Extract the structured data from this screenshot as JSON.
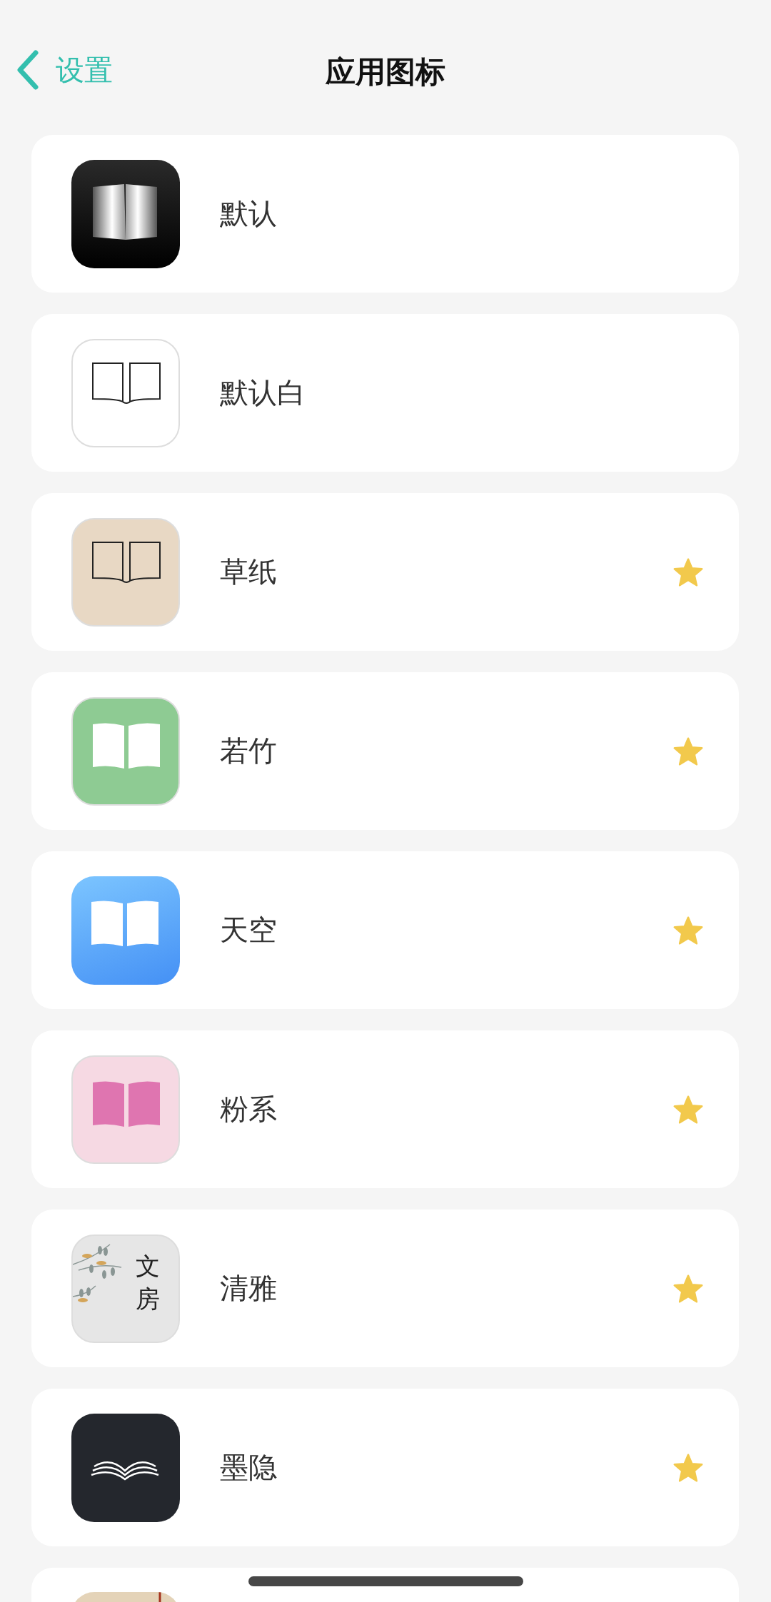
{
  "header": {
    "back_label": "设置",
    "title": "应用图标"
  },
  "icons": [
    {
      "kind": "dark-gradient",
      "label": "默认",
      "starred": false
    },
    {
      "kind": "outline-white",
      "label": "默认白",
      "starred": false
    },
    {
      "kind": "outline-beige",
      "label": "草纸",
      "starred": true
    },
    {
      "kind": "solid-green",
      "label": "若竹",
      "starred": true
    },
    {
      "kind": "solid-blue",
      "label": "天空",
      "starred": true
    },
    {
      "kind": "solid-pink",
      "label": "粉系",
      "starred": true
    },
    {
      "kind": "painting",
      "label": "清雅",
      "icon_text": "文房",
      "starred": true
    },
    {
      "kind": "dark-lines",
      "label": "墨隐",
      "starred": true
    },
    {
      "kind": "partial-beige"
    }
  ]
}
